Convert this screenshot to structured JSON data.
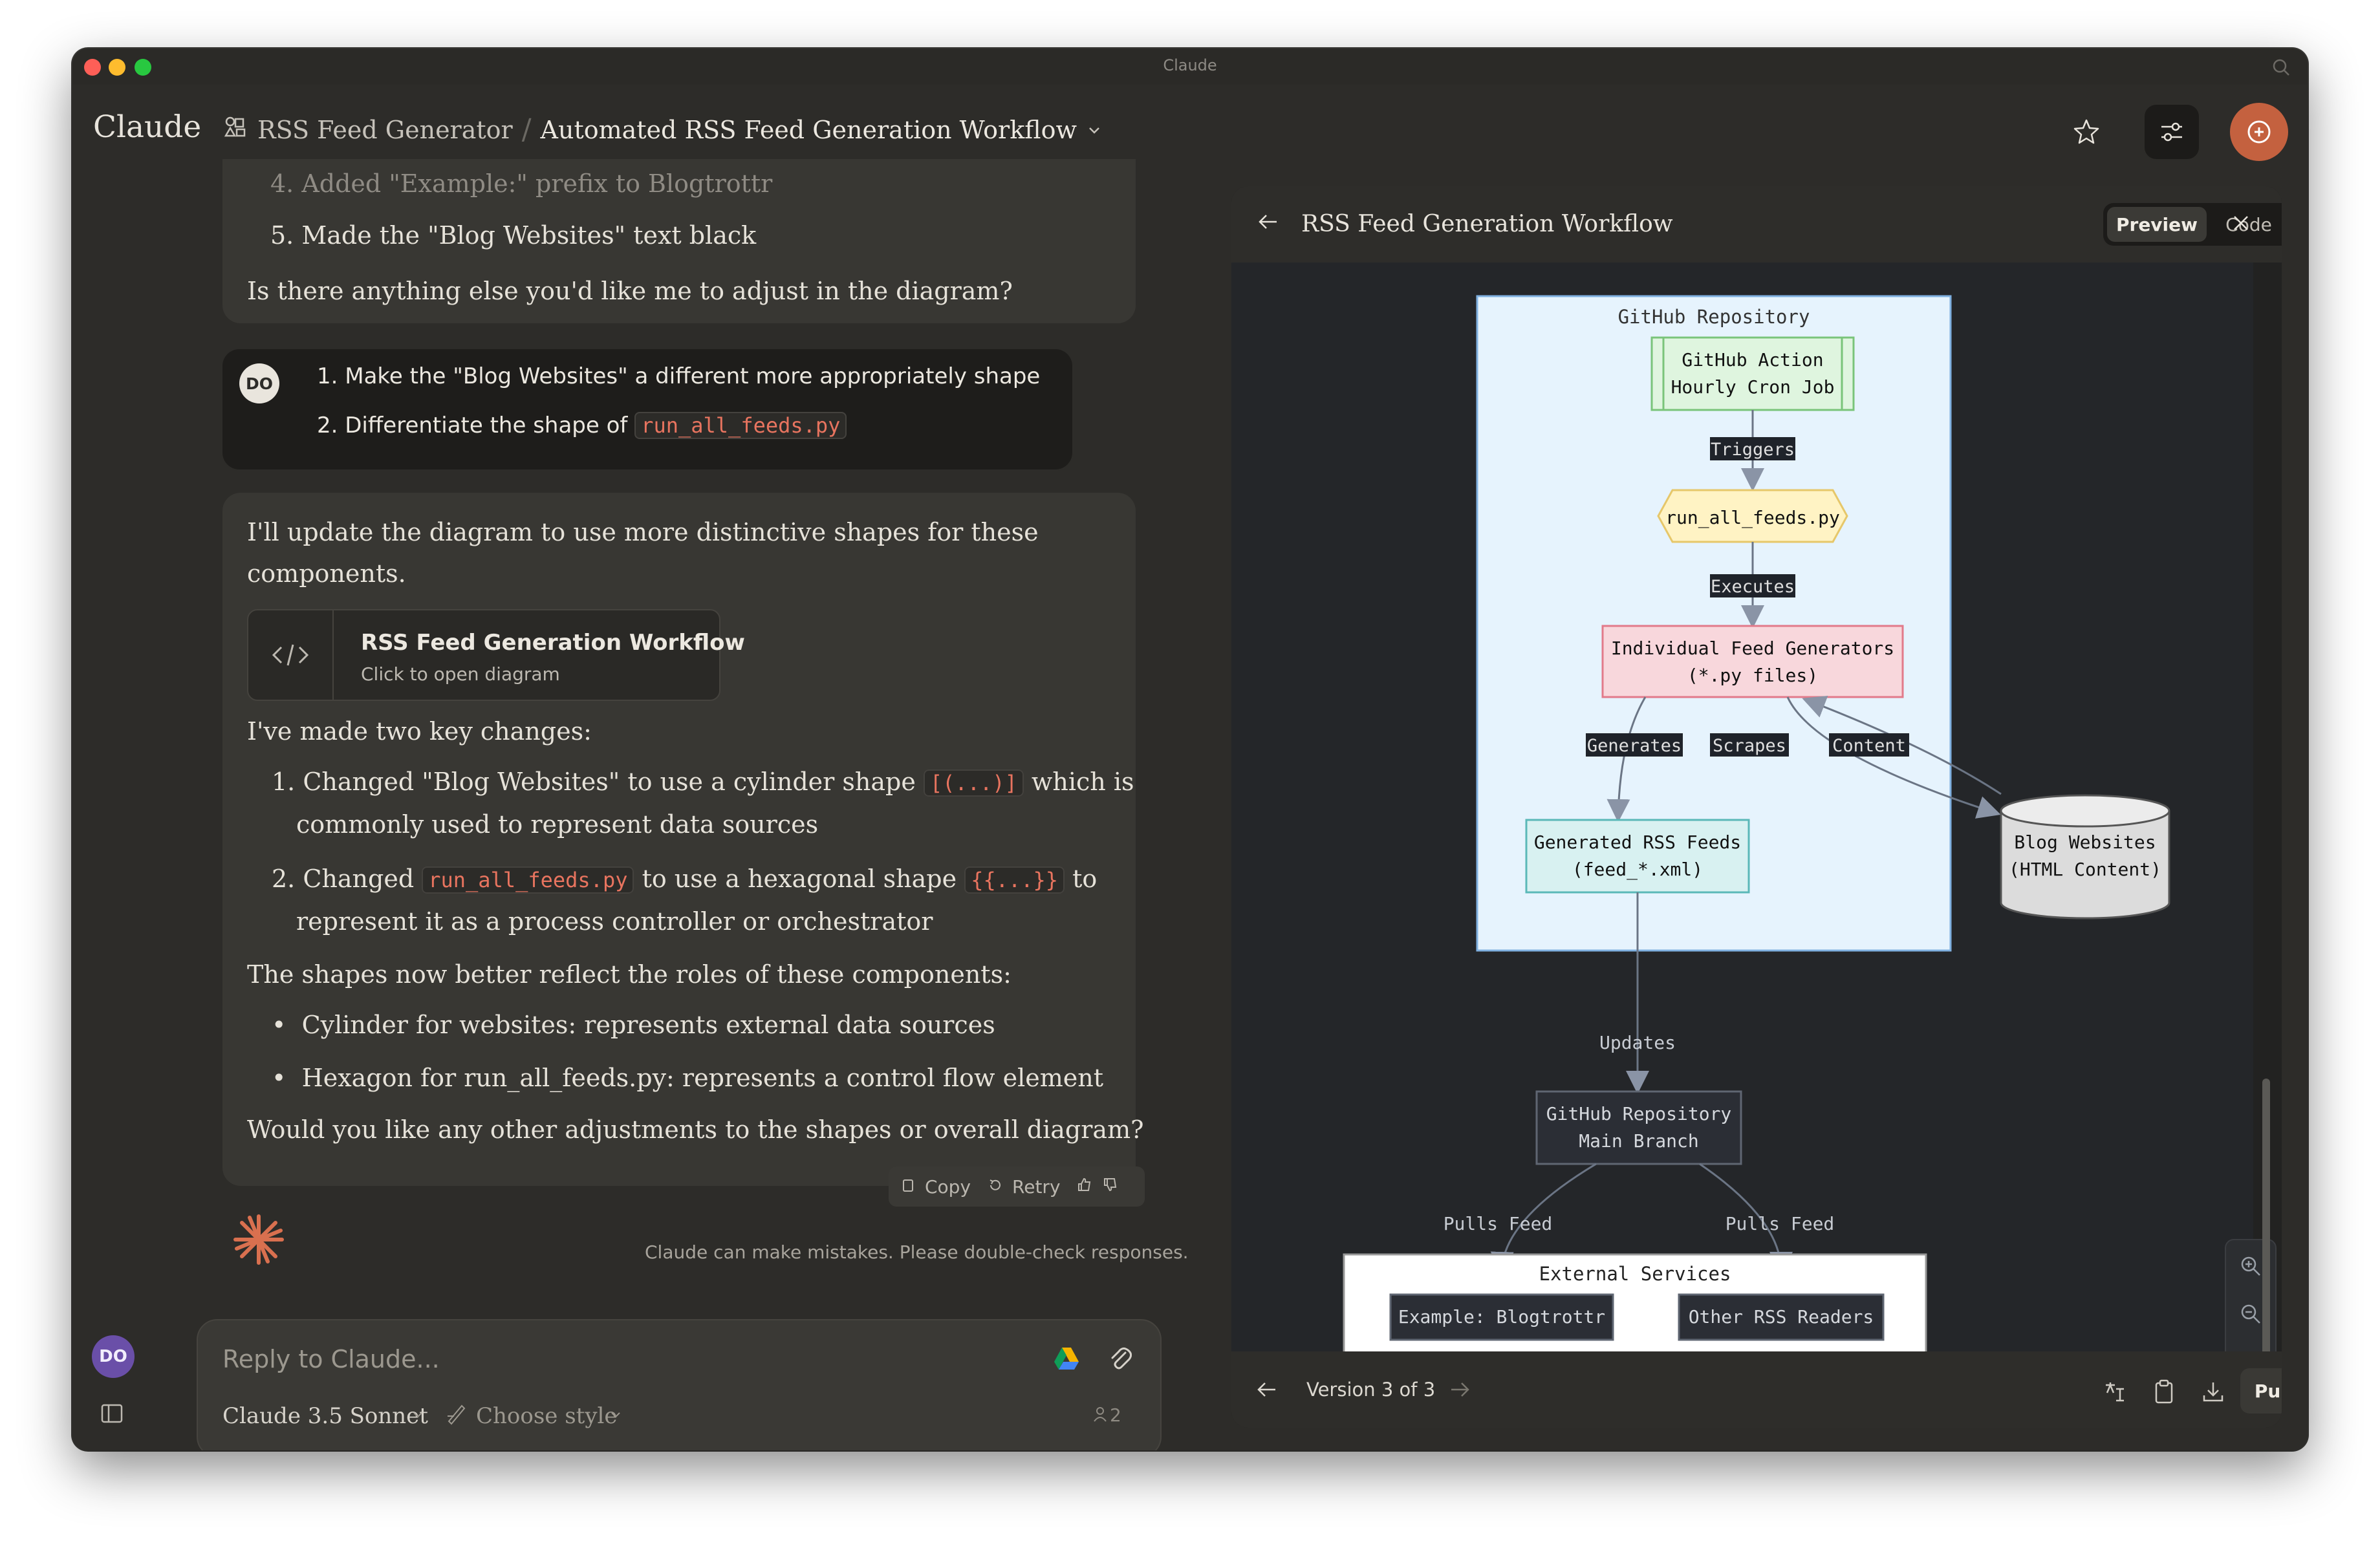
{
  "window": {
    "title": "Claude"
  },
  "header": {
    "logo": "Claude",
    "project": "RSS Feed Generator",
    "chat_title": "Automated RSS Feed Generation Workflow"
  },
  "chat": {
    "prev_item_4": "4. Added \"Example:\" prefix to Blogtrottr",
    "prev_item_5": "5. Made the \"Blog Websites\" text black",
    "prev_question": "Is there anything else you'd like me to adjust in the diagram?",
    "user_initials": "DO",
    "user_line1": "1. Make the \"Blog Websites\" a different more appropriately shape",
    "user_line2_pre": "2. Differentiate the shape of ",
    "user_line2_code": "run_all_feeds.py",
    "ai_intro_1": "I'll update the diagram to use more distinctive shapes for these",
    "ai_intro_2": "components.",
    "artifact_title": "RSS Feed Generation Workflow",
    "artifact_sub": "Click to open diagram",
    "changes_heading": "I've made two key changes:",
    "change1_pre": "1. Changed \"Blog Websites\" to use a cylinder shape ",
    "change1_code": "[(...)]",
    "change1_post": " which is",
    "change1_line2": "commonly used to represent data sources",
    "change2_pre": "2. Changed ",
    "change2_code1": "run_all_feeds.py",
    "change2_mid": " to use a hexagonal shape ",
    "change2_code2": "{{...}}",
    "change2_post": " to",
    "change2_line2": "represent it as a process controller or orchestrator",
    "roles_heading": "The shapes now better reflect the roles of these components:",
    "bullet1": "Cylinder for websites: represents external data sources",
    "bullet2": "Hexagon for run_all_feeds.py: represents a control flow element",
    "closing": "Would you like any other adjustments to the shapes or overall diagram?",
    "copy": "Copy",
    "retry": "Retry",
    "disclaimer": "Claude can make mistakes. Please double-check responses."
  },
  "composer": {
    "placeholder": "Reply to Claude...",
    "model": "Claude 3.5 Sonnet",
    "style": "Choose style",
    "count": "2"
  },
  "sidebar": {
    "user_initials": "DO"
  },
  "artifact": {
    "title": "RSS Feed Generation Workflow",
    "tab_preview": "Preview",
    "tab_code": "Code",
    "version": "Version 3 of 3",
    "publish": "Publish",
    "diagram": {
      "repo_label": "GitHub Repository",
      "action_1": "GitHub Action",
      "action_2": "Hourly Cron Job",
      "triggers": "Triggers",
      "runner": "run_all_feeds.py",
      "executes": "Executes",
      "gen_1": "Individual Feed Generators",
      "gen_2": "(*.py files)",
      "generates": "Generates",
      "scrapes": "Scrapes",
      "content": "Content",
      "feeds_1": "Generated RSS Feeds",
      "feeds_2": "(feed_*.xml)",
      "blogs_1": "Blog Websites",
      "blogs_2": "(HTML Content)",
      "updates": "Updates",
      "main_1": "GitHub Repository",
      "main_2": "Main Branch",
      "pulls_left": "Pulls Feed",
      "pulls_right": "Pulls Feed",
      "external": "External Services",
      "blogtrottr": "Example: Blogtrottr",
      "other": "Other RSS Readers"
    }
  },
  "colors": {
    "accent": "#c4613f",
    "code_text": "#e8745f",
    "repo_bg": "#e6f3fd",
    "action_bg": "#dff5df",
    "runner_bg": "#fff3c4",
    "gen_bg": "#f8d7dc",
    "feeds_bg": "#d8f1f1"
  }
}
